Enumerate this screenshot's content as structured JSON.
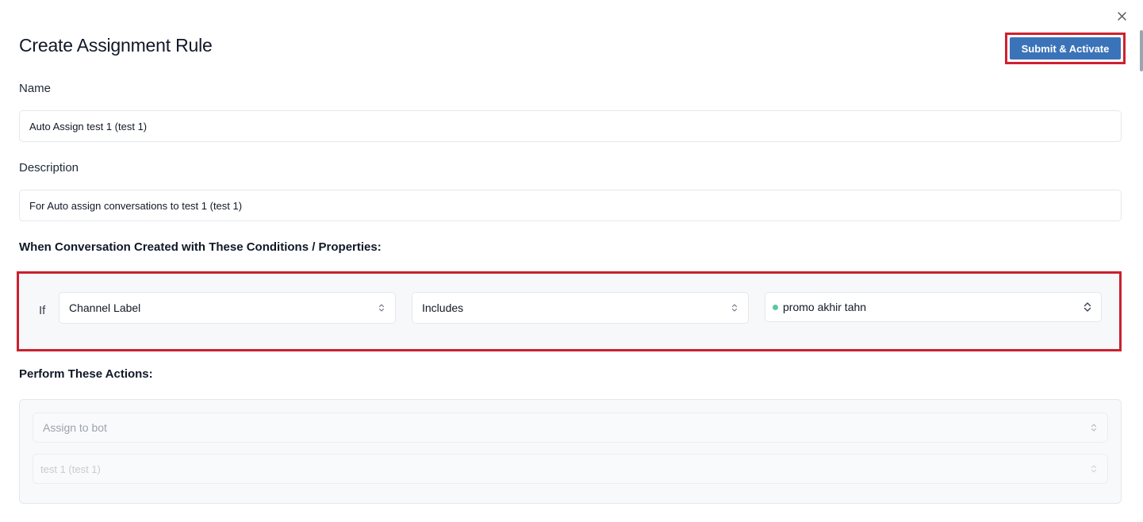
{
  "modal": {
    "title": "Create Assignment Rule",
    "submit_label": "Submit & Activate",
    "close_icon": "close-icon"
  },
  "form": {
    "name": {
      "label": "Name",
      "value": "Auto Assign test 1 (test 1)"
    },
    "description": {
      "label": "Description",
      "value": "For Auto assign conversations to test 1 (test 1)"
    }
  },
  "conditions": {
    "heading": "When Conversation Created with These Conditions / Properties:",
    "if_label": "If",
    "property": "Channel Label",
    "operator": "Includes",
    "value": "promo akhir tahn",
    "value_dot_color": "#5cc8a0"
  },
  "actions": {
    "heading": "Perform These Actions:",
    "action_type": "Assign to bot",
    "target": "test 1 (test 1)"
  },
  "colors": {
    "accent": "#3b73b9",
    "highlight": "#d0202f"
  }
}
